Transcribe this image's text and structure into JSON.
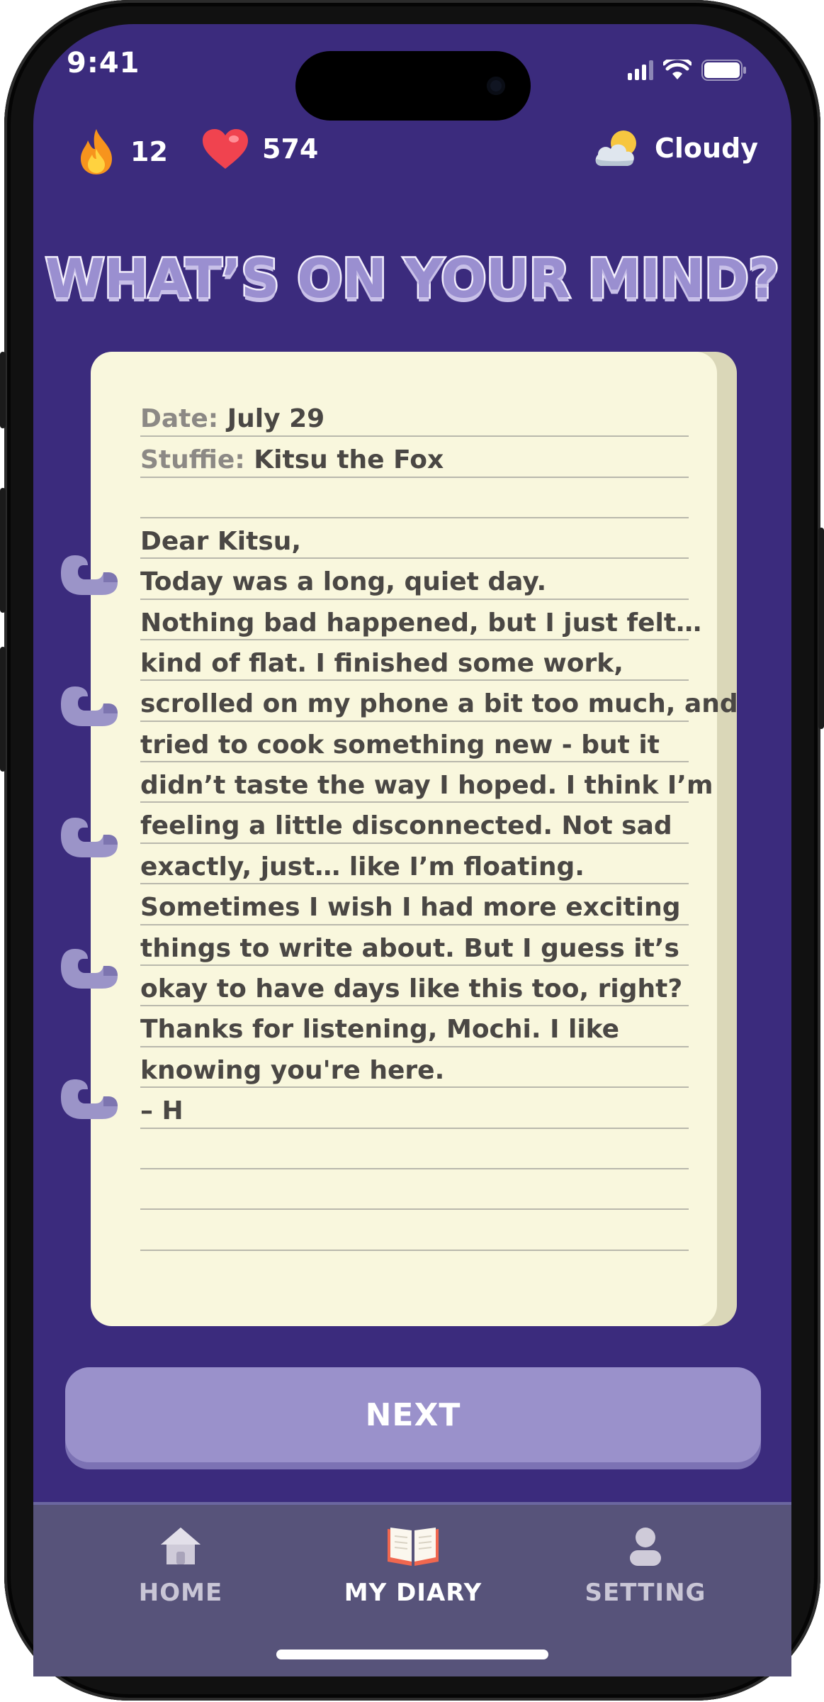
{
  "status_bar": {
    "time": "9:41",
    "icons": [
      "cellular-signal-icon",
      "wifi-icon",
      "battery-icon"
    ]
  },
  "header": {
    "streak_count": "12",
    "hearts_count": "574",
    "weather_label": "Cloudy"
  },
  "title": "WHAT’S ON YOUR MIND?",
  "diary": {
    "date_label": "Date:",
    "date_value": "July 29",
    "stuffie_label": "Stuffie:",
    "stuffie_value": "Kitsu the Fox",
    "body_lines": [
      "Dear Kitsu,",
      "Today was a long, quiet day.",
      "Nothing bad happened, but I just felt…",
      "kind of flat. I finished some work,",
      "scrolled on my phone a bit too much, and",
      "tried to cook something new - but it",
      "didn’t taste the way I hoped. I think I’m",
      "feeling a little disconnected. Not sad",
      "exactly, just… like I’m floating.",
      "Sometimes I wish I had more exciting",
      "things to write about. But I guess it’s",
      "okay to have days like this too, right?",
      "Thanks for listening, Mochi. I like",
      "knowing you're here.",
      "– H"
    ]
  },
  "next_button": {
    "label": "NEXT"
  },
  "tabs": [
    {
      "label": "HOME",
      "icon": "home-icon",
      "active": false
    },
    {
      "label": "MY DIARY",
      "icon": "open-book-icon",
      "active": true
    },
    {
      "label": "SETTING",
      "icon": "person-icon",
      "active": false
    }
  ],
  "colors": {
    "background": "#3b2b7d",
    "card": "#f9f7dd",
    "button": "#9a91cb",
    "tabbar": "#57537a",
    "tab_inactive": "#c9c6d6",
    "tab_active": "#ffffff"
  }
}
